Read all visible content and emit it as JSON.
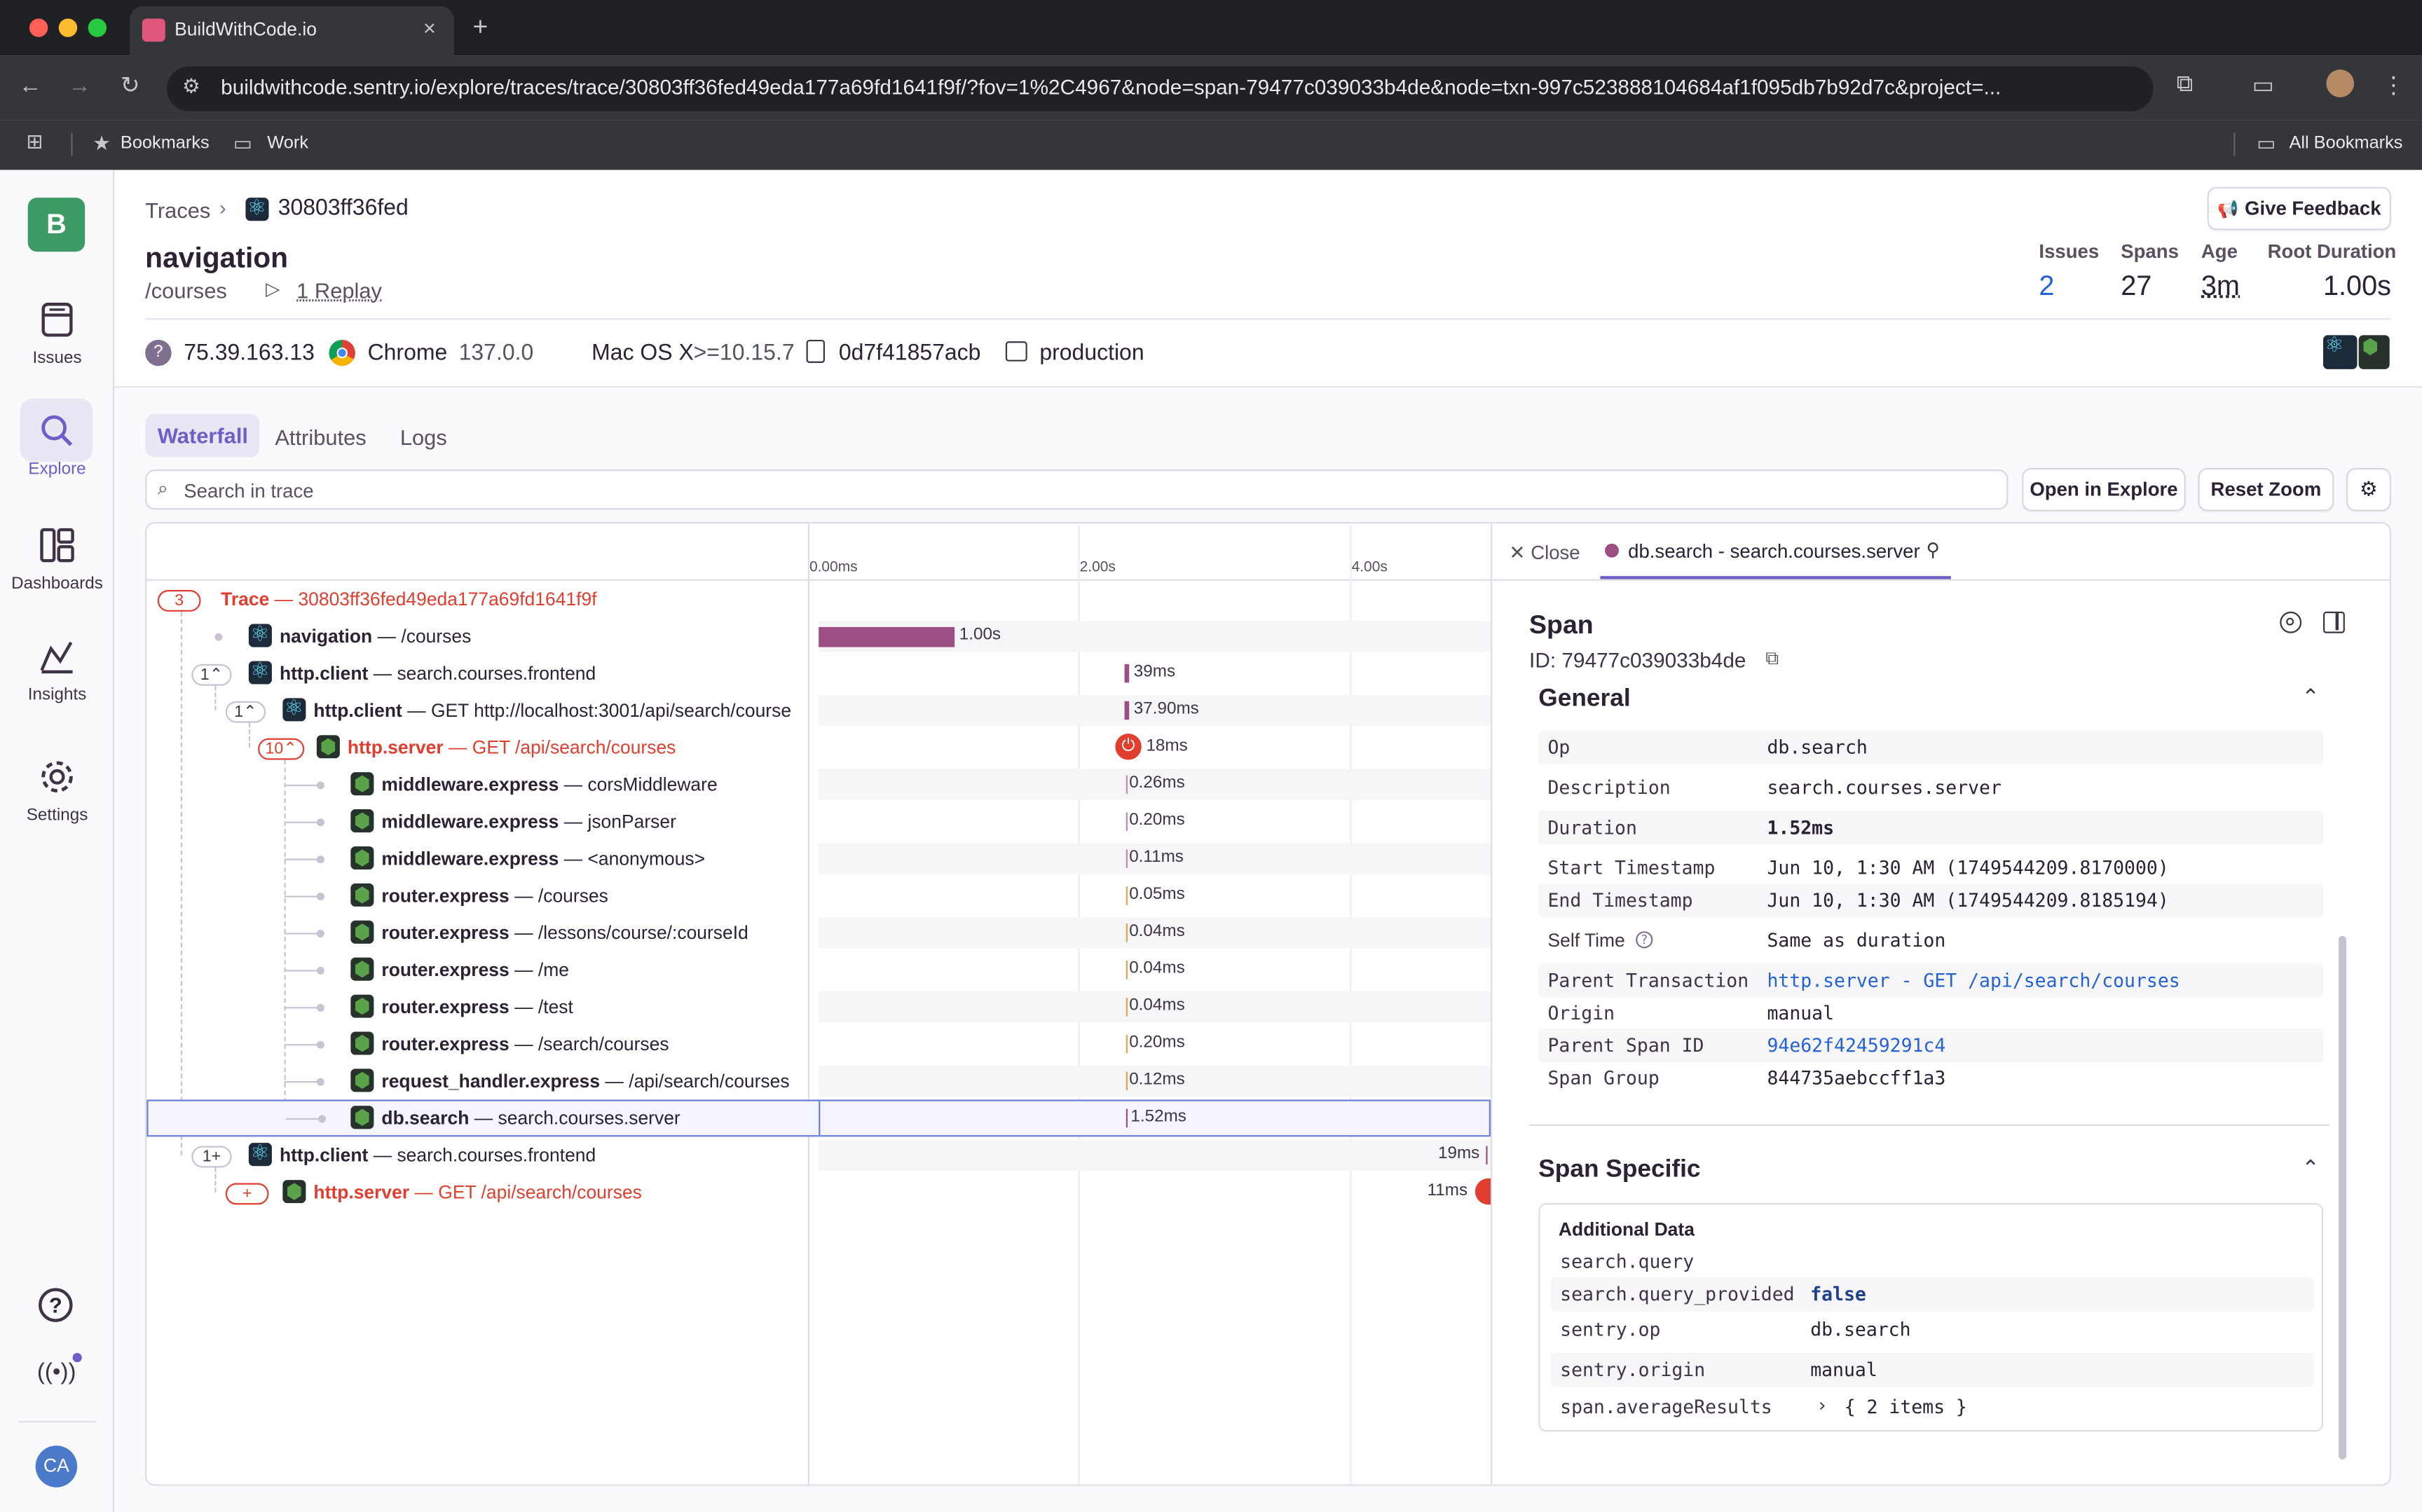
{
  "browser": {
    "tab_title": "BuildWithCode.io",
    "url": "buildwithcode.sentry.io/explore/traces/trace/30803ff36fed49eda177a69fd1641f9f/?fov=1%2C4967&node=span-79477c039033b4de&node=txn-997c523888104684af1f095db7b92d7c&project=...",
    "bookmarks": [
      "Bookmarks",
      "Work"
    ],
    "all_bookmarks": "All Bookmarks"
  },
  "sidebar": {
    "org_initial": "B",
    "items": [
      {
        "label": "Issues",
        "icon": "issues-icon"
      },
      {
        "label": "Explore",
        "icon": "search-icon"
      },
      {
        "label": "Dashboards",
        "icon": "dashboards-icon"
      },
      {
        "label": "Insights",
        "icon": "insights-icon"
      },
      {
        "label": "Settings",
        "icon": "gear-icon"
      }
    ],
    "user_initials": "CA"
  },
  "header": {
    "breadcrumb_root": "Traces",
    "breadcrumb_id": "30803ff36fed",
    "title": "navigation",
    "subtitle": "/courses",
    "replay": "1 Replay",
    "feedback": "Give Feedback",
    "stats": [
      {
        "label": "Issues",
        "value": "2"
      },
      {
        "label": "Spans",
        "value": "27"
      },
      {
        "label": "Age",
        "value": "3m"
      },
      {
        "label": "Root Duration",
        "value": "1.00s"
      }
    ]
  },
  "context_tags": {
    "ip": "75.39.163.13",
    "browser": "Chrome",
    "browser_version": "137.0.0",
    "os": "Mac OS X",
    "os_version": ">=10.15.7",
    "device": "0d7f41857acb",
    "environment": "production"
  },
  "tabs": [
    "Waterfall",
    "Attributes",
    "Logs"
  ],
  "search": {
    "placeholder": "Search in trace"
  },
  "actions": {
    "open_explore": "Open in Explore",
    "reset_zoom": "Reset Zoom"
  },
  "timeline": {
    "ticks": [
      "0.00ms",
      "2.00s",
      "4.00s"
    ]
  },
  "trace_rows": [
    {
      "badge": "3",
      "op": "Trace",
      "desc": "30803ff36fed49eda177a69fd1641f9f",
      "error": true,
      "icon": "",
      "dur": ""
    },
    {
      "badge": "",
      "op": "navigation",
      "desc": "/courses",
      "icon": "react",
      "dur": "1.00s"
    },
    {
      "badge": "1",
      "op": "http.client",
      "desc": "search.courses.frontend",
      "icon": "react",
      "dur": "39ms"
    },
    {
      "badge": "1",
      "op": "http.client",
      "desc": "GET http://localhost:3001/api/search/course",
      "icon": "react",
      "dur": "37.90ms"
    },
    {
      "badge": "10",
      "op": "http.server",
      "desc": "GET /api/search/courses",
      "error": true,
      "icon": "node",
      "dur": "18ms"
    },
    {
      "op": "middleware.express",
      "desc": "corsMiddleware",
      "icon": "node",
      "dur": "0.26ms"
    },
    {
      "op": "middleware.express",
      "desc": "jsonParser",
      "icon": "node",
      "dur": "0.20ms"
    },
    {
      "op": "middleware.express",
      "desc": "<anonymous>",
      "icon": "node",
      "dur": "0.11ms"
    },
    {
      "op": "router.express",
      "desc": "/courses",
      "icon": "node",
      "dur": "0.05ms"
    },
    {
      "op": "router.express",
      "desc": "/lessons/course/:courseId",
      "icon": "node",
      "dur": "0.04ms"
    },
    {
      "op": "router.express",
      "desc": "/me",
      "icon": "node",
      "dur": "0.04ms"
    },
    {
      "op": "router.express",
      "desc": "/test",
      "icon": "node",
      "dur": "0.04ms"
    },
    {
      "op": "router.express",
      "desc": "/search/courses",
      "icon": "node",
      "dur": "0.20ms"
    },
    {
      "op": "request_handler.express",
      "desc": "/api/search/courses",
      "icon": "node",
      "dur": "0.12ms"
    },
    {
      "op": "db.search",
      "desc": "search.courses.server",
      "icon": "node",
      "dur": "1.52ms"
    },
    {
      "badge": "1",
      "op": "http.client",
      "desc": "search.courses.frontend",
      "icon": "react",
      "dur": "19ms"
    },
    {
      "badge": "+",
      "op": "http.server",
      "desc": "GET /api/search/courses",
      "error": true,
      "icon": "node",
      "dur": "11ms"
    }
  ],
  "panel": {
    "close": "Close",
    "tab": "db.search - search.courses.server",
    "title": "Span",
    "id": "ID: 79477c039033b4de",
    "general_title": "General",
    "general": [
      {
        "k": "Op",
        "v": "db.search"
      },
      {
        "k": "Description",
        "v": "search.courses.server"
      },
      {
        "k": "Duration",
        "v": "1.52ms"
      },
      {
        "k": "Start Timestamp",
        "v": "Jun 10, 1:30 AM (1749544209.8170000)"
      },
      {
        "k": "End Timestamp",
        "v": "Jun 10, 1:30 AM (1749544209.8185194)"
      },
      {
        "k": "Self Time",
        "v": "Same as duration"
      },
      {
        "k": "Parent Transaction",
        "v": "http.server - GET /api/search/courses"
      },
      {
        "k": "Origin",
        "v": "manual"
      },
      {
        "k": "Parent Span ID",
        "v": "94e62f42459291c4"
      },
      {
        "k": "Span Group",
        "v": "844735aebccff1a3"
      }
    ],
    "specific_title": "Span Specific",
    "additional_title": "Additional Data",
    "additional": [
      {
        "k": "search.query",
        "v": ""
      },
      {
        "k": "search.query_provided",
        "v": "false"
      },
      {
        "k": "sentry.op",
        "v": "db.search"
      },
      {
        "k": "sentry.origin",
        "v": "manual"
      },
      {
        "k": "span.averageResults",
        "v": "{ 2 items }"
      }
    ]
  },
  "colors": {
    "accent": "#6c5fc7",
    "error": "#e03e2f",
    "bar": "#9c4f82",
    "link": "#2562d4"
  }
}
